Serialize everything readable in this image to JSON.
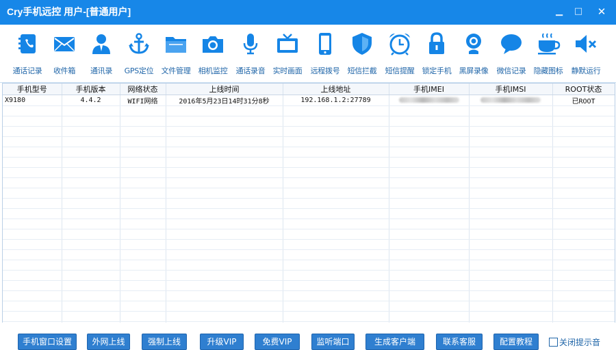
{
  "window": {
    "title": "Cry手机远控 用户-[普通用户]",
    "minimize_glyph": "▁",
    "maximize_glyph": "□",
    "close_glyph": "✕"
  },
  "colors": {
    "accent": "#1787e8",
    "icon": "#1585e6",
    "button": "#2f7fd0",
    "label": "#1f65a8"
  },
  "toolbar": [
    {
      "label": "通话记录",
      "icon": "address-book-icon"
    },
    {
      "label": "收件箱",
      "icon": "envelope-icon"
    },
    {
      "label": "通讯录",
      "icon": "person-icon"
    },
    {
      "label": "GPS定位",
      "icon": "anchor-icon"
    },
    {
      "label": "文件管理",
      "icon": "folder-icon"
    },
    {
      "label": "相机监控",
      "icon": "camera-icon"
    },
    {
      "label": "通话录音",
      "icon": "microphone-icon"
    },
    {
      "label": "实时画面",
      "icon": "tv-icon"
    },
    {
      "label": "远程拨号",
      "icon": "smartphone-icon"
    },
    {
      "label": "短信拦截",
      "icon": "shield-icon"
    },
    {
      "label": "短信提醒",
      "icon": "alarm-clock-icon"
    },
    {
      "label": "锁定手机",
      "icon": "lock-icon"
    },
    {
      "label": "黑屏录像",
      "icon": "webcam-icon"
    },
    {
      "label": "微信记录",
      "icon": "chat-bubble-icon"
    },
    {
      "label": "隐藏图标",
      "icon": "coffee-cup-icon"
    },
    {
      "label": "静默运行",
      "icon": "mute-speaker-icon"
    }
  ],
  "table": {
    "columns": [
      "手机型号",
      "手机版本",
      "网络状态",
      "上线时间",
      "上线地址",
      "手机IMEI",
      "手机IMSI",
      "ROOT状态"
    ],
    "rows": [
      {
        "model": "X9180",
        "version": "4.4.2",
        "network": "WIFI网络",
        "online_time": "2016年5月23日14时31分8秒",
        "address": "192.168.1.2:27789",
        "root": "已ROOT"
      }
    ]
  },
  "bottom_buttons": [
    "手机窗口设置",
    "外网上线",
    "强制上线",
    "升级VIP",
    "免费VIP",
    "监听端口",
    "生成客户端",
    "联系客服",
    "配置教程"
  ],
  "checkbox": {
    "label": "关闭提示音",
    "checked": false
  }
}
